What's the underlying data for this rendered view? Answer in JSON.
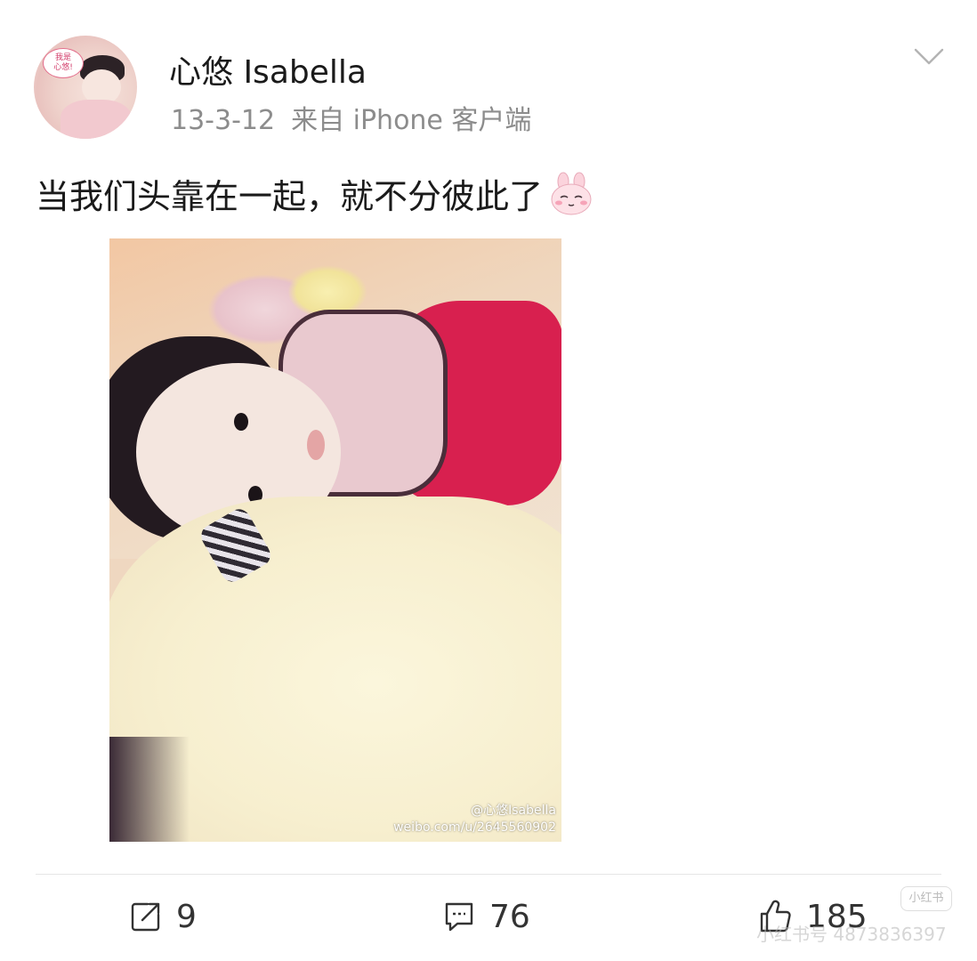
{
  "post": {
    "username": "心悠 Isabella",
    "date": "13-3-12",
    "source": "来自 iPhone 客户端",
    "text": "当我们头靠在一起，就不分彼此了",
    "emoji": "bunny-shy-emoji",
    "avatar_bubble": "我是\n心悠!",
    "photo_watermark_user": "@心悠Isabella",
    "photo_watermark_url": "weibo.com/u/2645560902"
  },
  "actions": {
    "repost_count": "9",
    "comment_count": "76",
    "like_count": "185"
  },
  "overlay": {
    "badge": "小红书",
    "id_text": "小红书号 4873836397"
  },
  "icons": {
    "more": "chevron-down-icon",
    "repost": "repost-icon",
    "comment": "comment-icon",
    "like": "thumbs-up-icon"
  },
  "colors": {
    "text_primary": "#1a1a1a",
    "text_meta": "#8c8c8c",
    "divider": "#e6e6e6"
  }
}
